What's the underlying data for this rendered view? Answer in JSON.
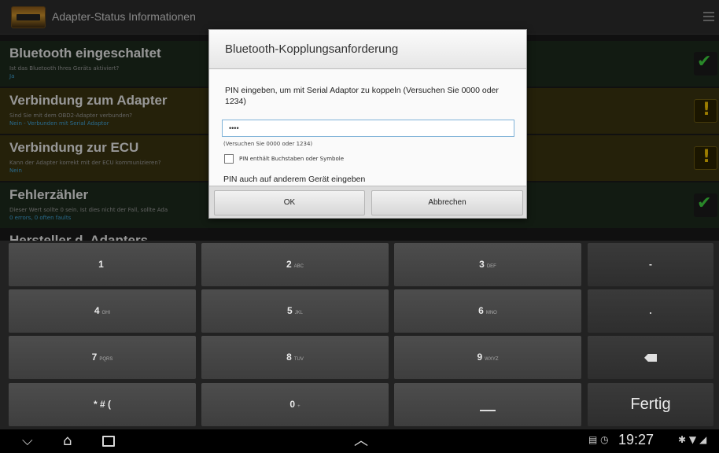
{
  "app": {
    "title": "Adapter-Status Informationen",
    "rows": [
      {
        "title": "Bluetooth eingeschaltet",
        "desc": "Ist das Bluetooth Ihres Geräts aktiviert?",
        "sub": "Ja",
        "status": "ok"
      },
      {
        "title": "Verbindung zum Adapter",
        "desc": "Sind Sie mit dem OBD2-Adapter verbunden?",
        "sub": "Nein - Verbunden mit Serial Adaptor",
        "status": "warning"
      },
      {
        "title": "Verbindung zur ECU",
        "desc": "Kann der Adapter korrekt mit der ECU kommunizieren?",
        "sub": "Nein",
        "status": "warning"
      },
      {
        "title": "Fehlerzähler",
        "desc": "Dieser Wert sollte 0 sein. Ist dies nicht der Fall, sollte Ada",
        "sub": "0 errors, 0 often faults",
        "status": "ok"
      }
    ],
    "partial_row_title": "Hersteller d. Adapters"
  },
  "dialog": {
    "title": "Bluetooth-Kopplungsanforderung",
    "message": "PIN eingeben, um mit Serial Adaptor zu koppeln (Versuchen Sie 0000 oder 1234)",
    "pin_value": "••••",
    "pin_hint": "(Versuchen Sie 0000 oder 1234)",
    "alnum_label": "PIN enthält Buchstaben oder Symbole",
    "alnum_checked": false,
    "other_device_text": "PIN auch auf anderem Gerät eingeben",
    "ok_label": "OK",
    "cancel_label": "Abbrechen"
  },
  "keyboard": {
    "keys": [
      {
        "main": "1",
        "sub": ""
      },
      {
        "main": "2",
        "sub": "ABC"
      },
      {
        "main": "3",
        "sub": "DEF"
      },
      {
        "main": "-",
        "sub": ""
      },
      {
        "main": "4",
        "sub": "GHI"
      },
      {
        "main": "5",
        "sub": "JKL"
      },
      {
        "main": "6",
        "sub": "MNO"
      },
      {
        "main": ".",
        "sub": ""
      },
      {
        "main": "7",
        "sub": "PQRS"
      },
      {
        "main": "8",
        "sub": "TUV"
      },
      {
        "main": "9",
        "sub": "WXYZ"
      },
      {
        "main": "* # (",
        "sub": ""
      },
      {
        "main": "0",
        "sub": "+"
      }
    ],
    "done_label": "Fertig"
  },
  "systembar": {
    "clock": "19:27"
  }
}
